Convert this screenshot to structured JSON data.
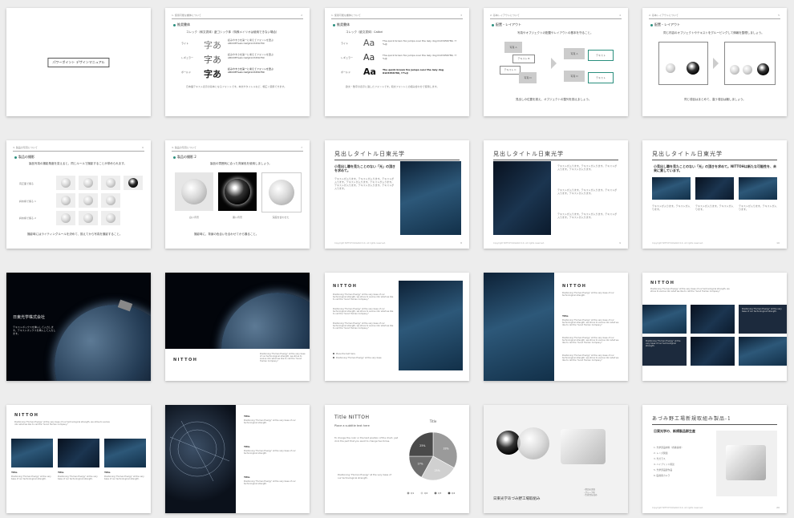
{
  "s1": {
    "title": "パワーポイント デザインマニュアル"
  },
  "s2": {
    "header": "1. 使用可能な書体について",
    "page": "2",
    "section": "推奨書体",
    "note_title": "コレック（和文書体）遊ゴシック体（特殊メイリオは使用できない場合）",
    "rows": [
      {
        "weight": "ライト",
        "glyph": "字あ",
        "text": "読みやすさを第一に考えてフォントを選ぶ ABCDEFGabcdefg0123456789"
      },
      {
        "weight": "レギュラー",
        "glyph": "字あ",
        "text": "読みやすさを第一に考えてフォントを選ぶ ABCDEFGabcdefg0123456789"
      },
      {
        "weight": "ボールド",
        "glyph": "字あ",
        "text": "読みやすさを第一に考えてフォントを選ぶ ABCDEFGabcdefg0123456789"
      }
    ],
    "footnote": "日本語テキスト表示の基本となるフォントです。本文やタイトルなど、幅広く使用できます。"
  },
  "s3": {
    "header": "1. 使用可能な書体について",
    "page": "3",
    "section": "推奨書体",
    "note_title": "コレック（欧文書体）Calibri",
    "rows": [
      {
        "weight": "ライト",
        "glyph": "Aa",
        "text": "The quick brown fox jumps over the lazy dog 0123456789, !?%@"
      },
      {
        "weight": "レギュラー",
        "glyph": "Aa",
        "text": "The quick brown fox jumps over the lazy dog 0123456789, !?%@"
      },
      {
        "weight": "ボールド",
        "glyph": "Aa",
        "text": "The quick brown fox jumps over the lazy dog 0123456789, !?%@"
      }
    ],
    "footnote": "欧文・数字の表示に適したフォントです。和文フォントとの組み合わせで使用します。"
  },
  "s4": {
    "header": "2. 基本レイアウトについて",
    "page": "4",
    "section": "配置・レイアウト",
    "intro": "写真やオブジェクトの配置やレイアウトの基本を守ること。",
    "boxes": [
      "写真 A",
      "テキスト B",
      "テキスト C",
      "写真 D",
      "テキスト",
      "テキスト"
    ],
    "bottom": "見出しの位置を揃え、オブジェクトの整列を揃えましょう。"
  },
  "s5": {
    "header": "2. 基本レイアウトについて",
    "page": "5",
    "section": "配置・レイアウト",
    "intro": "同じ内容のオブジェクトやテキストをグルーピングして情報を整理しましょう。",
    "bottom": "同じ項目はまとめて、違う項目は離しましょう。"
  },
  "s6": {
    "header": "3. 製品の写真について",
    "page": "6",
    "section": "製品の撮影",
    "intro": "製品写真の撮影角度を変えると、同じルールで撮影することが求められます。",
    "rows": [
      "真正面で撮る",
      "斜め横で撮る 1",
      "斜め横で撮る 2"
    ],
    "bottom": "撮影時にはライティングルールを決めて、揃えてから写真を撮影すること。"
  },
  "s7": {
    "header": "3. 製品の写真について",
    "page": "7",
    "section": "製品の撮影 2",
    "intro": "製品の雰囲気に合った背景色を使用しましょう。",
    "captions": [
      "白い背景",
      "黒い背景",
      "深度を合わせた"
    ],
    "bottom": "撮影時に、背景の色合いを合わせてから撮ること。"
  },
  "s8": {
    "title": "見出しタイトル日東光学",
    "lead": "小見出し職を見たことのない「光」の頂きを求めて。",
    "body": "テキストが入ります。テキストが入ります。テキストが入ります。テキストが入ります。テキストが入ります。テキストが入ります。テキストが入ります。テキストが入ります。",
    "footer": "Copyright NITTOH KOGAKU K.K. All rights reserved.",
    "page": "8"
  },
  "s9": {
    "title": "見出しタイトル日東光学",
    "body": "テキストが入ります。テキストが入ります。テキストが入ります。テキストが入ります。",
    "footer": "Copyright NITTOH KOGAKU K.K. All rights reserved.",
    "page": "9"
  },
  "s10": {
    "title": "見出しタイトル日東光学",
    "lead": "小見出し職を見たことのない「光」の頂きを求めて。NITTOHは新たな可能性を、未来に賞しています。",
    "body": "テキストが入ります。テキストが入ります。",
    "footer": "Copyright NITTOH KOGAKU K.K. All rights reserved.",
    "page": "10"
  },
  "s11": {
    "company": "日東光学株式会社",
    "text": "テキストボックスを挿入して入力します。テキストボックスを挿入して入力します。"
  },
  "s12": {
    "logo": "NITTOH",
    "text": "Positioning \"Human Energy\" at the very base of our technological strength, we strive to evolve into what we like to call the \"Good Human Company.\""
  },
  "s13": {
    "logo": "NITTOH",
    "body": "Positioning \"Human Energy\" at the very base of our technological strength, we strive to evolve into what we like to call the \"Good Human Company.\"",
    "bullets": [
      "Place the text here.",
      "Positioning \"Human Energy\" at the very base"
    ]
  },
  "s14": {
    "logo": "NITTOH",
    "text": "Positioning \"Human Energy\" at the very base of our technological strength.",
    "label": "Title",
    "body": "Positioning \"Human Energy\" at the very base of our technological strength, we strive to evolve into what we like to call the \"Good Human Company.\""
  },
  "s15": {
    "logo": "NITTOH",
    "text": "Positioning \"Human Energy\" at the very base of our technological strength, we strive to evolve into what we like to call the \"Good Human Company.\"",
    "box1": "Positioning \"Human Energy\" at the very base of our technological strength.",
    "box2": "Positioning \"Human Energy\" at the very base of our technological strength."
  },
  "s16": {
    "logo": "NITTOH",
    "text": "Positioning \"Human Energy\" at the very base of our technological strength, we strive to evolve into what we like to call the \"Good Human Company.\"",
    "cols": [
      {
        "label": "Title",
        "body": "Positioning \"Human Energy\" at the very base of our technological strength."
      },
      {
        "label": "Title",
        "body": "Positioning \"Human Energy\" at the very base of our technological strength."
      },
      {
        "label": "Title",
        "body": "Positioning \"Human Energy\" at the very base of our technological strength."
      }
    ]
  },
  "s17": {
    "items": [
      {
        "label": "Title",
        "body": "Positioning \"Human Energy\" at the very base of our technological strength."
      },
      {
        "label": "Title",
        "body": "Positioning \"Human Energy\" at the very base of our technological strength."
      },
      {
        "label": "Title",
        "body": "Positioning \"Human Energy\" at the very base of our technological strength."
      }
    ]
  },
  "s18": {
    "title": "Title NITTOH",
    "subtitle": "Place a subtitle text here",
    "body": "To change the color or the text position of the chart, just click the part that you want to change two times.",
    "quote": "Positioning \"Human Energy\" at the very base of our technological strength."
  },
  "s19": {
    "company_jp": "日東光学あづみ野工場取組み",
    "list": [
      "・製品を追加",
      "・グループ化",
      "・生産性を高め"
    ]
  },
  "s20": {
    "title": "あづみ野工場新規取組み製品-1",
    "lead": "日東光学の、新規製品群生産",
    "list": [
      "1. 光学部品材料（各種素材）",
      "2. レンズ関連",
      "3. 光ガラス",
      "4. ハイブリッド用途",
      "5. 光学部品製作品",
      "6. 医療用カメラ"
    ],
    "footer": "Copyright NITTOH KOGAKU K.K. All rights reserved.",
    "page": "20"
  },
  "chart_data": {
    "type": "pie",
    "title": "Title",
    "categories": [
      "Q1",
      "Q2",
      "Q3",
      "Q4"
    ],
    "values": [
      33,
      25,
      17,
      25
    ],
    "labels": [
      "33%",
      "25%",
      "17%",
      "25%"
    ],
    "colors": [
      "#9a9a9a",
      "#d0d0d0",
      "#6e6e6e",
      "#4a4a4a"
    ]
  }
}
